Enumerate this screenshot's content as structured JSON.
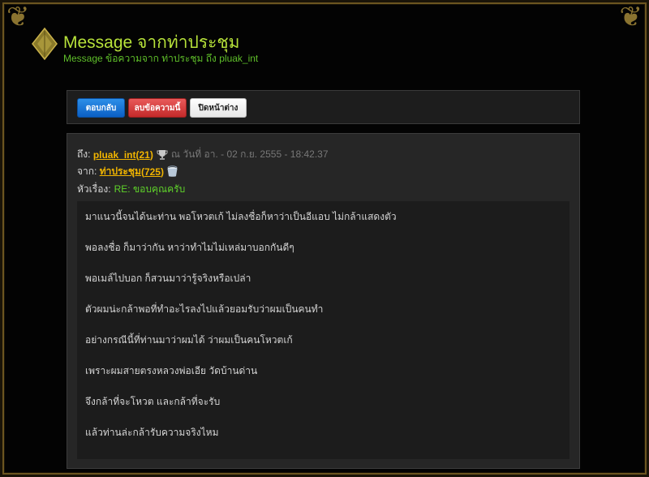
{
  "header": {
    "title": "Message จากท่าประชุม",
    "subtitle": "Message ข้อความจาก ท่าประชุม ถึง pluak_int"
  },
  "toolbar": {
    "reply_label": "ตอบกลับ",
    "delete_label": "ลบข้อความนี้",
    "close_label": "ปิดหน้าต่าง"
  },
  "message": {
    "to_label": "ถึง:",
    "to_user": "pluak_int",
    "to_count_open": "(",
    "to_count": "21",
    "to_count_close": ")",
    "date_text": "ณ วันที่ อา. - 02 ก.ย. 2555 - 18:42.37",
    "from_label": "จาก:",
    "from_user": "ท่าประชุม",
    "from_count_open": "(",
    "from_count": "725",
    "from_count_close": ")",
    "subject_label": "หัวเรื่อง:",
    "subject": "RE: ขอบคุณครับ",
    "lines": [
      "มาแนวนี้จนได้นะท่าน พอโหวตเก้ ไม่ลงชื่อก็หาว่าเป็นอีแอบ ไม่กล้าแสดงตัว",
      "พอลงชื่อ ก็มาว่ากัน หาว่าทำไมไม่เหล่มาบอกกันดีๆ",
      "พอเมล์ไปบอก ก็สวนมาว่ารู้จริงหรือเปล่า",
      "ตัวผมน่ะกล้าพอที่ทำอะไรลงไปแล้วยอมรับว่าผมเป็นคนทำ",
      "อย่างกรณีนี้ที่ท่านมาว่าผมได้ ว่าผมเป็นคนโหวตเก้",
      "เพราะผมสายตรงหลวงพ่อเอีย วัดบ้านด่าน",
      "จึงกล้าที่จะโหวต และกล้าที่จะรับ",
      "แล้วท่านล่ะกล้ารับความจริงไหม"
    ]
  },
  "colors": {
    "title": "#b7e23a",
    "subtitle": "#5fbf2a",
    "link": "#f0b400",
    "subject": "#5fd32a",
    "reply_button": "#0b5fc4",
    "delete_button": "#c42a2a"
  },
  "icons": {
    "logo": "golden-leaf-emblem-icon",
    "trophy": "trophy-icon",
    "bucket": "bucket-icon"
  }
}
